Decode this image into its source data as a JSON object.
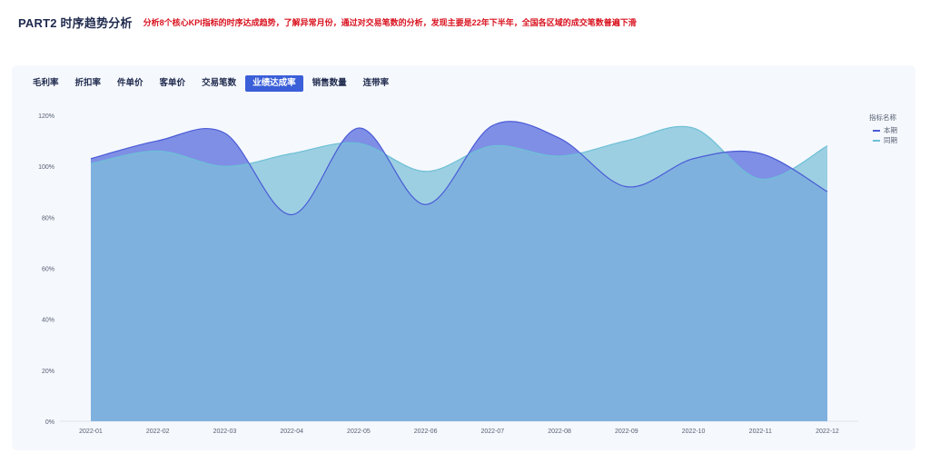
{
  "header": {
    "title": "PART2 时序趋势分析",
    "description": "分析8个核心KPI指标的时序达成趋势，了解异常月份，通过对交易笔数的分析，发现主要是22年下半年，全国各区域的成交笔数普遍下滑"
  },
  "tabs": [
    {
      "label": "毛利率",
      "active": false
    },
    {
      "label": "折扣率",
      "active": false
    },
    {
      "label": "件单价",
      "active": false
    },
    {
      "label": "客单价",
      "active": false
    },
    {
      "label": "交易笔数",
      "active": false
    },
    {
      "label": "业绩达成率",
      "active": true
    },
    {
      "label": "销售数量",
      "active": false
    },
    {
      "label": "连带率",
      "active": false
    }
  ],
  "legend": {
    "title": "指标名称",
    "items": [
      {
        "name": "本期",
        "color": "#4a5bd6"
      },
      {
        "name": "同期",
        "color": "#6cc0d6"
      }
    ]
  },
  "colors": {
    "accent": "#3a5fd9",
    "title_red": "#d9121f",
    "current_fill": "#7f8fe6",
    "previous_fill": "#9ccfe2",
    "overlap_fill": "#7fb1de"
  },
  "chart_data": {
    "type": "area",
    "title": "",
    "xlabel": "",
    "ylabel": "",
    "ylim": [
      0,
      120
    ],
    "y_ticks": [
      "0%",
      "20%",
      "40%",
      "60%",
      "80%",
      "100%",
      "120%"
    ],
    "categories": [
      "2022-01",
      "2022-02",
      "2022-03",
      "2022-04",
      "2022-05",
      "2022-06",
      "2022-07",
      "2022-08",
      "2022-09",
      "2022-10",
      "2022-11",
      "2022-12"
    ],
    "series": [
      {
        "name": "本期",
        "values": [
          103,
          110,
          113,
          81,
          115,
          85,
          116,
          111,
          92,
          103,
          105,
          90
        ]
      },
      {
        "name": "同期",
        "values": [
          101,
          106,
          100,
          105,
          109,
          98,
          108,
          104,
          110,
          115,
          95,
          108
        ]
      }
    ],
    "grid": false,
    "legend_position": "right"
  }
}
